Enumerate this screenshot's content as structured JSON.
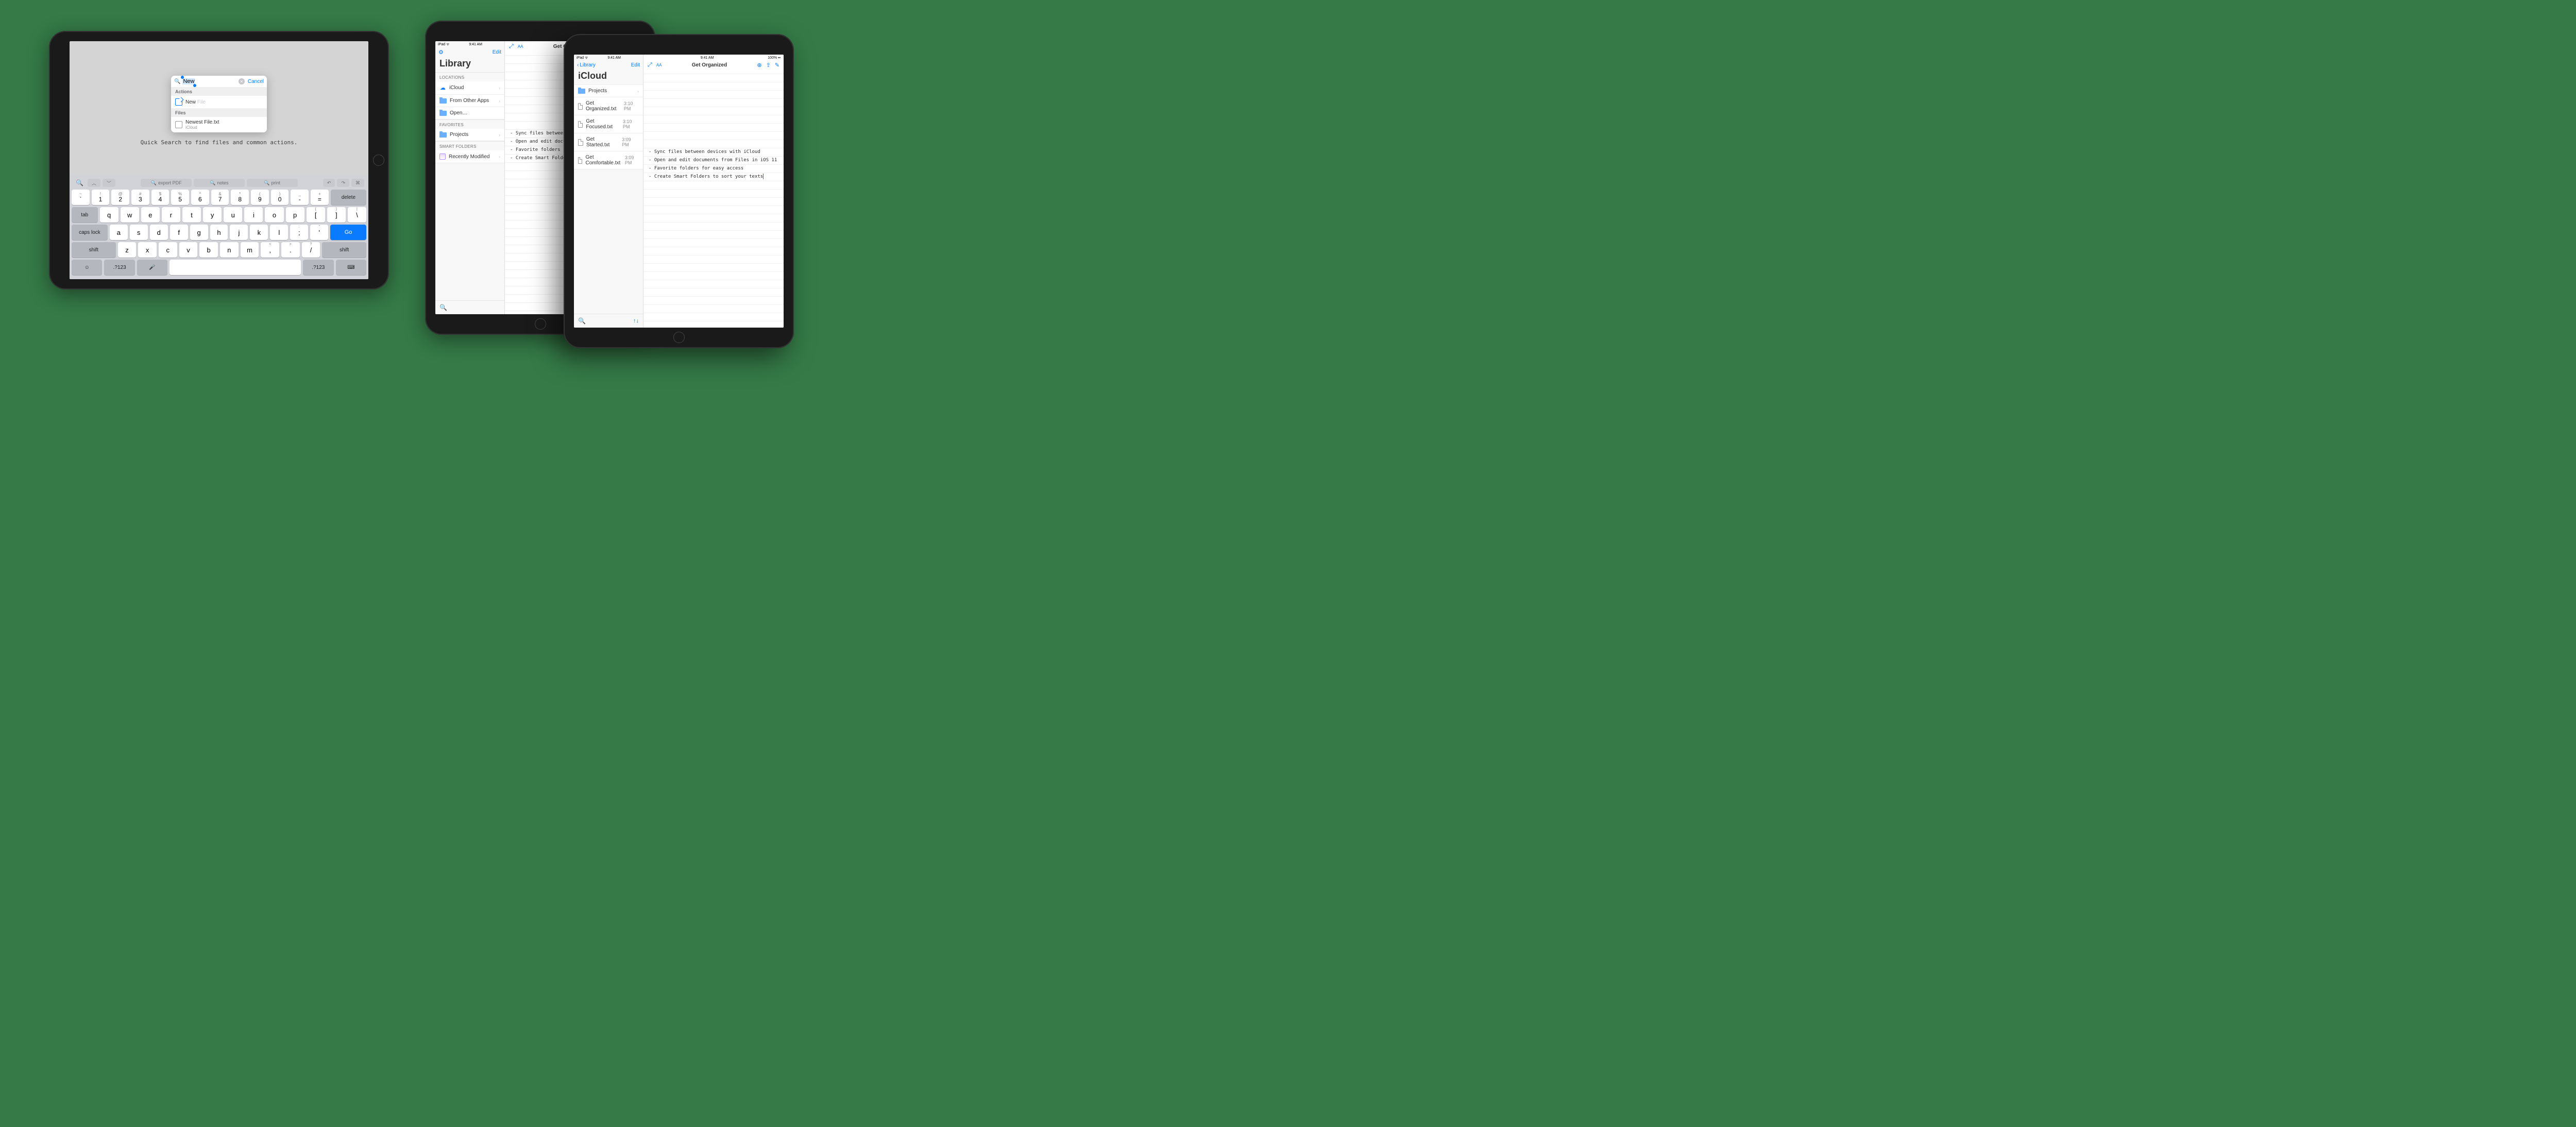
{
  "status": {
    "left": "iPad ᯤ",
    "time": "9:41 AM",
    "batt": "100%"
  },
  "ipad1": {
    "caption": "Quick Search to find files and common actions.",
    "search": {
      "query": "New",
      "cancel": "Cancel"
    },
    "sections": {
      "actions": {
        "header": "Actions",
        "item": {
          "label": "New",
          "suffix": " File"
        }
      },
      "files": {
        "header": "Files",
        "item": {
          "name": "Newest File.txt",
          "loc": "iCloud"
        }
      }
    },
    "toolbar": {
      "s1": "export PDF",
      "s2": "notes",
      "s3": "print"
    },
    "keys": {
      "row1_alts": [
        "`",
        "1",
        "2",
        "3",
        "4",
        "5",
        "6",
        "7",
        "8",
        "9",
        "0",
        "-",
        "=",
        "delete"
      ],
      "row1_syms": [
        "~",
        "!",
        "@",
        "#",
        "$",
        "%",
        "^",
        "&",
        "*",
        "(",
        ")",
        "_",
        "+",
        ""
      ],
      "row2": [
        "tab",
        "q",
        "w",
        "e",
        "r",
        "t",
        "y",
        "u",
        "i",
        "o",
        "p",
        "[",
        "]",
        "\\"
      ],
      "row2_alts": [
        "",
        "",
        "",
        "",
        "",
        "",
        "",
        "",
        "",
        "",
        "",
        "{",
        "}",
        "|"
      ],
      "row3": [
        "caps lock",
        "a",
        "s",
        "d",
        "f",
        "g",
        "h",
        "j",
        "k",
        "l",
        ";",
        "'",
        "Go"
      ],
      "row3_alts": [
        "",
        "",
        "",
        "",
        "",
        "",
        "",
        "",
        "",
        "",
        ":",
        "\"",
        ""
      ],
      "row4": [
        "shift",
        "z",
        "x",
        "c",
        "v",
        "b",
        "n",
        "m",
        ",",
        ".",
        "/",
        "shift"
      ],
      "row4_alts": [
        "",
        "",
        "",
        "",
        "",
        "",
        "",
        "",
        "<",
        ">",
        "?",
        ""
      ],
      "row5": [
        "☺",
        ".?123",
        "🎤",
        "",
        ".?123",
        "⌨"
      ]
    }
  },
  "ipad2": {
    "sidebar": {
      "title": "Library",
      "edit": "Edit",
      "sections": {
        "locations": {
          "header": "LOCATIONS",
          "items": [
            "iCloud",
            "From Other Apps",
            "Open…"
          ]
        },
        "favorites": {
          "header": "FAVORITES",
          "items": [
            "Projects"
          ]
        },
        "smart": {
          "header": "SMART FOLDERS",
          "items": [
            "Recently Modified"
          ]
        }
      }
    },
    "editor": {
      "title": "Get Organized",
      "body": "- Sync files between devices with iCloud\n- Open and edit documents from Files in iOS 11\n- Favorite folders for easy access\n- Create Smart Folders to sort your texts"
    }
  },
  "ipad3": {
    "sidebar": {
      "back": "Library",
      "title": "iCloud",
      "edit": "Edit",
      "folder": {
        "name": "Projects"
      },
      "files": [
        {
          "name": "Get Organized.txt",
          "time": "3:10 PM"
        },
        {
          "name": "Get Focused.txt",
          "time": "3:10 PM"
        },
        {
          "name": "Get Started.txt",
          "time": "3:09 PM"
        },
        {
          "name": "Get Comfortable.txt",
          "time": "3:09 PM"
        }
      ]
    },
    "editor": {
      "title": "Get Organized",
      "body": "- Sync files between devices with iCloud\n- Open and edit documents from Files in iOS 11\n- Favorite folders for easy access\n- Create Smart Folders to sort your texts"
    }
  },
  "icons": {
    "gear": "⚙",
    "fs": "⤢",
    "aA": "AA",
    "plus": "⊕",
    "share": "⇪",
    "compose": "✎",
    "undo": "↶",
    "redo": "↷",
    "cmd": "⌘",
    "chevUp": "︿",
    "chevDown": "﹀",
    "sort": "↑↓"
  }
}
